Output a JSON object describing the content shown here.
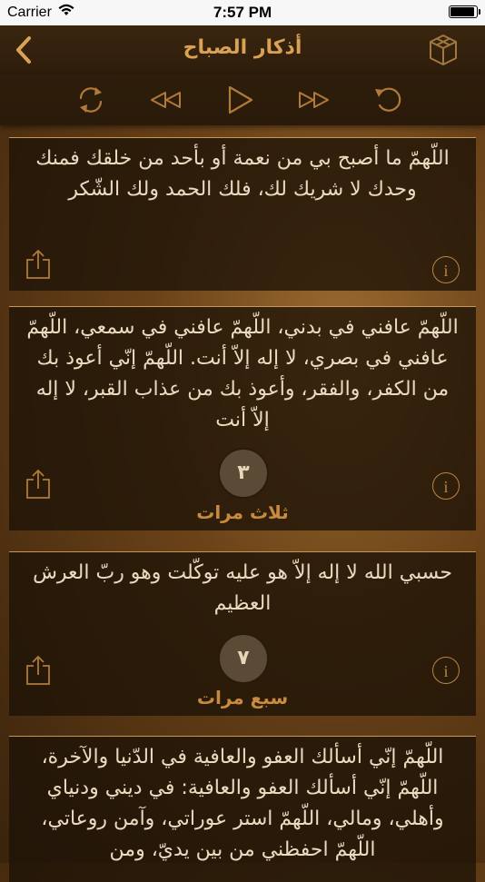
{
  "status": {
    "carrier": "Carrier",
    "time": "7:57 PM",
    "battery_level": 0.95
  },
  "nav": {
    "title": "أذكار الصباح",
    "back_icon": "chevron-left-icon",
    "right_icon": "box-icon",
    "accent": "#d9a254"
  },
  "toolbar": {
    "buttons": [
      "repeat-icon",
      "rewind-icon",
      "play-icon",
      "fast-forward-icon",
      "undo-icon"
    ]
  },
  "cards": [
    {
      "text": "اللّهمّ ما أصبح بي من نعمة أو بأحد من خلقك فمنك وحدك لا شريك لك، فلك الحمد ولك الشّكر",
      "count": "",
      "count_label": ""
    },
    {
      "text": "اللّهمّ عافني في بدني، اللّهمّ عافني في سمعي، اللّهمّ عافني في بصري، لا إله إلاّ أنت. اللّهمّ إنّي أعوذ بك من الكفر، والفقر، وأعوذ بك من عذاب القبر، لا إله إلاّ أنت",
      "count": "٣",
      "count_label": "ثلاث مرات"
    },
    {
      "text": "حسبي الله لا إله إلاّ هو عليه توكّلت وهو ربّ العرش العظيم",
      "count": "٧",
      "count_label": "سبع مرات"
    },
    {
      "text": "اللّهمّ إنّي أسألك العفو والعافية في الدّنيا والآخرة، اللّهمّ إنّي أسألك العفو والعافية: في ديني ودنياي وأهلي، ومالي، اللّهمّ استر عوراتي، وآمن روعاتي، اللّهمّ احفظني من بين يديّ، ومن",
      "count": "",
      "count_label": ""
    }
  ],
  "info_glyph": "i"
}
